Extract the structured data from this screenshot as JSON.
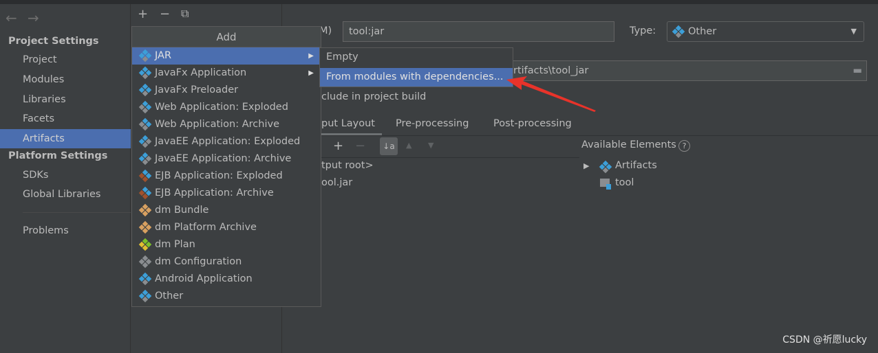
{
  "nav": {
    "back": "←",
    "forward": "→"
  },
  "sidebar": {
    "project_settings": "Project Settings",
    "items": [
      "Project",
      "Modules",
      "Libraries",
      "Facets",
      "Artifacts"
    ],
    "platform_settings": "Platform Settings",
    "platform_items": [
      "SDKs",
      "Global Libraries"
    ],
    "problems": "Problems",
    "selected": "Artifacts"
  },
  "toolbar": {
    "add": "+",
    "remove": "−",
    "copy": "⧉"
  },
  "menu": {
    "title": "Add",
    "items": [
      {
        "label": "JAR",
        "icon": "jar-diamond-icon",
        "submenu": true,
        "selected": true
      },
      {
        "label": "JavaFx Application",
        "icon": "diamond-icon",
        "submenu": true
      },
      {
        "label": "JavaFx Preloader",
        "icon": "diamond-icon"
      },
      {
        "label": "Web Application: Exploded",
        "icon": "web-icon"
      },
      {
        "label": "Web Application: Archive",
        "icon": "web-icon"
      },
      {
        "label": "JavaEE Application: Exploded",
        "icon": "javaee-icon"
      },
      {
        "label": "JavaEE Application: Archive",
        "icon": "javaee-icon"
      },
      {
        "label": "EJB Application: Exploded",
        "icon": "ejb-icon"
      },
      {
        "label": "EJB Application: Archive",
        "icon": "ejb-icon"
      },
      {
        "label": "dm Bundle",
        "icon": "bundle-icon"
      },
      {
        "label": "dm Platform Archive",
        "icon": "bundle-icon"
      },
      {
        "label": "dm Plan",
        "icon": "plan-icon"
      },
      {
        "label": "dm Configuration",
        "icon": "file-icon"
      },
      {
        "label": "Android Application",
        "icon": "diamond-icon"
      },
      {
        "label": "Other",
        "icon": "diamond-icon"
      }
    ]
  },
  "submenu": {
    "items": [
      "Empty",
      "From modules with dependencies..."
    ],
    "selected": "From modules with dependencies..."
  },
  "form": {
    "name_label_fragment": "M)",
    "name_value": "tool:jar",
    "type_label": "Type:",
    "type_value": "Other",
    "output_dir_fragment": "rtifacts\\tool_jar",
    "include_fragment": "clude in project build"
  },
  "tabs": [
    "put Layout",
    "Pre-processing",
    "Post-processing"
  ],
  "layout_tree": [
    "tput root>",
    "ool.jar"
  ],
  "available": {
    "title": "Available Elements",
    "help": "?",
    "items": [
      "Artifacts",
      "tool"
    ]
  },
  "watermark": "CSDN @祈愿lucky",
  "colors": {
    "selection": "#4b6eaf",
    "background": "#3c3f41",
    "arrow": "#e8332a"
  }
}
